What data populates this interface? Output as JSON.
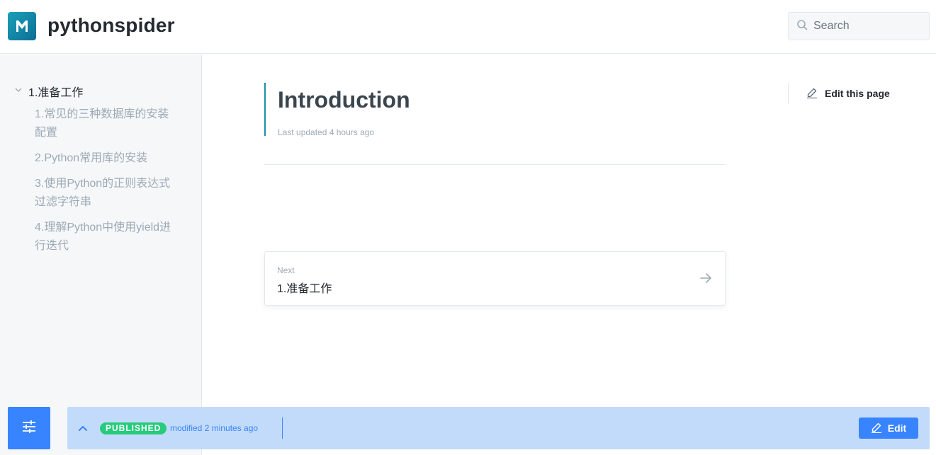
{
  "header": {
    "site_title": "pythonspider",
    "logo_letter": "M",
    "search_placeholder": "Search"
  },
  "sidebar": {
    "group_label": "1.准备工作",
    "items": [
      {
        "label_line1": "1.常见的三种数据库的安装",
        "label_line2": "配置"
      },
      {
        "label_line1": "2.Python常用库的安装",
        "label_line2": ""
      },
      {
        "label_line1": "3.使用Python的正则表达式",
        "label_line2": "过滤字符串"
      },
      {
        "label_line1": "4.理解Python中使用yield进",
        "label_line2": "行迭代"
      }
    ]
  },
  "main": {
    "title": "Introduction",
    "last_updated": "Last updated 4 hours ago",
    "edit_page_label": "Edit this page",
    "next": {
      "caption": "Next",
      "title": "1.准备工作"
    }
  },
  "status_bar": {
    "badge": "PUBLISHED",
    "modified": "modified 2 minutes ago",
    "edit_label": "Edit"
  },
  "colors": {
    "accent": "#3884ff",
    "teal": "#1a8ea6",
    "published_green": "#26cb7c",
    "status_bar_bg": "#c3dbfb"
  },
  "icons": {
    "search": "search-icon",
    "chevron": "chevron-down-icon",
    "pencil": "pencil-icon",
    "arrow": "arrow-right-icon",
    "sliders": "sliders-icon",
    "collapse": "chevron-up-icon"
  }
}
